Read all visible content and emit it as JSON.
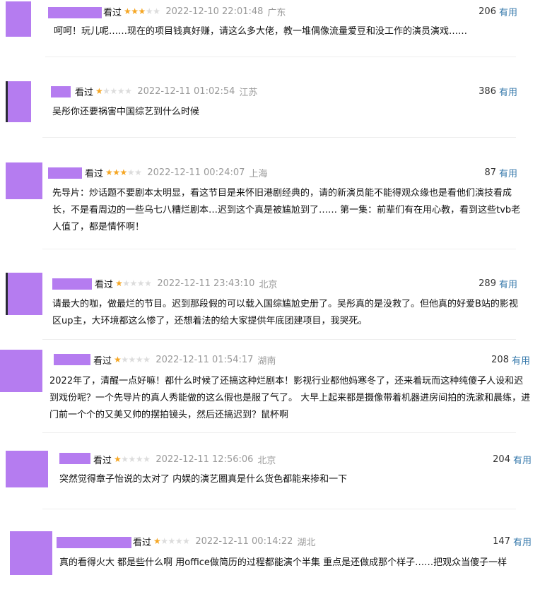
{
  "reviews": [
    {
      "watched": "看过",
      "rating": 3,
      "time": "2022-12-10 22:01:48",
      "location": "广东",
      "votes": "206",
      "useful": "有用",
      "text": "呵呵！玩儿呢……现在的项目钱真好赚，请这么多大佬，教一堆偶像流量爱豆和没工作的演员演戏……"
    },
    {
      "watched": "看过",
      "rating": 1,
      "time": "2022-12-11 01:02:54",
      "location": "江苏",
      "votes": "386",
      "useful": "有用",
      "text": "吴彤你还要祸害中国综艺到什么时候"
    },
    {
      "watched": "看过",
      "rating": 3,
      "time": "2022-12-11 00:24:07",
      "location": "上海",
      "votes": "87",
      "useful": "有用",
      "text": "先导片：炒话题不要剧本太明显，看这节目是来怀旧港剧经典的，请的新演员能不能得观众缘也是看他们演技看成长，不是看周边的一些乌七八糟烂剧本…迟到这个真是被尴尬到了…… 第一集：前辈们有在用心教，看到这些tvb老人值了，都是情怀啊！"
    },
    {
      "watched": "看过",
      "rating": 1,
      "time": "2022-12-11 23:43:10",
      "location": "北京",
      "votes": "289",
      "useful": "有用",
      "text": "请最大的咖，做最烂的节目。迟到那段假的可以载入国综尴尬史册了。吴彤真的是没救了。但他真的好爱B站的影视区up主，大环境都这么惨了，还想着法的给大家提供年底团建项目，我哭死。"
    },
    {
      "watched": "看过",
      "rating": 1,
      "time": "2022-12-11 01:54:17",
      "location": "湖南",
      "votes": "208",
      "useful": "有用",
      "text": "2022年了，清醒一点好嘛！都什么时候了还搞这种烂剧本！影视行业都他妈寒冬了，还来着玩而这种纯傻子人设和迟到戏份呢？一个先导片的真人秀能做的这么假也是服了气了。 大早上起来都是摄像带着机器进房间拍的洗漱和晨练，进门前一个个的又美又帅的摆拍镜头，然后还搞迟到？鼠杯啊"
    },
    {
      "watched": "看过",
      "rating": 1,
      "time": "2022-12-11 12:56:06",
      "location": "北京",
      "votes": "204",
      "useful": "有用",
      "text": "突然觉得章子怡说的太对了 内娱的演艺圈真是什么货色都能来掺和一下"
    },
    {
      "watched": "看过",
      "rating": 1,
      "time": "2022-12-11 00:14:22",
      "location": "湖北",
      "votes": "147",
      "useful": "有用",
      "text": "真的看得火大 都是些什么啊 用office做简历的过程都能演个半集 重点是还做成那个样子……把观众当傻子一样"
    }
  ]
}
